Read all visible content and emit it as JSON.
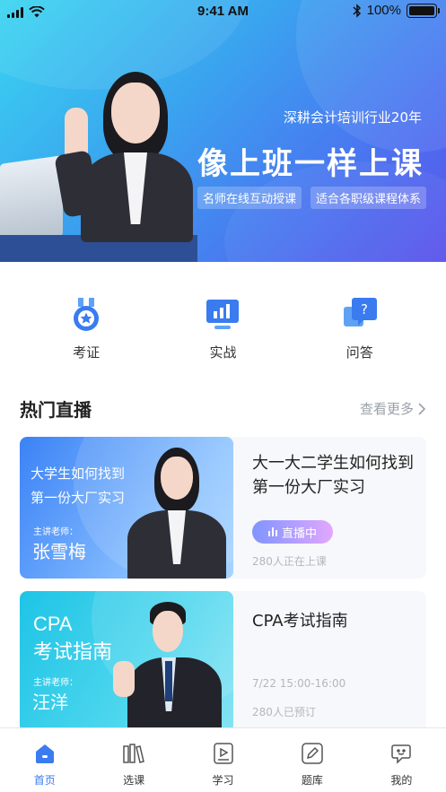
{
  "status_bar": {
    "time": "9:41 AM",
    "battery": "100%",
    "battery_level": 1.0
  },
  "banner": {
    "tagline": "深耕会计培训行业20年",
    "title": "像上班一样上课",
    "tags": [
      "名师在线互动授课",
      "适合各职级课程体系"
    ]
  },
  "quick_entries": [
    {
      "label": "考证",
      "icon": "medal-icon"
    },
    {
      "label": "实战",
      "icon": "monitor-chart-icon"
    },
    {
      "label": "问答",
      "icon": "question-bubble-icon"
    }
  ],
  "hot_live": {
    "title": "热门直播",
    "more_label": "查看更多"
  },
  "courses": [
    {
      "thumb_headline": [
        "大学生如何找到",
        "第一份大厂实习"
      ],
      "teacher_label": "主讲老师：",
      "teacher_name": "张雪梅",
      "title": "大一大二学生如何找到第一份大厂实习",
      "badge": "直播中",
      "meta_lines": [
        "280人正在上课"
      ]
    },
    {
      "thumb_headline": [
        "CPA",
        "考试指南"
      ],
      "teacher_label": "主讲老师：",
      "teacher_name": "汪洋",
      "title": "CPA考试指南",
      "badge": "",
      "meta_lines": [
        "7/22 15:00-16:00",
        "280人已预订"
      ]
    }
  ],
  "tab_bar": [
    {
      "label": "首页",
      "icon": "home-icon",
      "active": true
    },
    {
      "label": "选课",
      "icon": "books-icon",
      "active": false
    },
    {
      "label": "学习",
      "icon": "play-doc-icon",
      "active": false
    },
    {
      "label": "题库",
      "icon": "pen-icon",
      "active": false
    },
    {
      "label": "我的",
      "icon": "profile-icon",
      "active": false
    }
  ],
  "colors": {
    "accent": "#3a7bf0",
    "banner_start": "#39d5f0",
    "banner_end": "#5b52ea",
    "live_badge_start": "#7f95ff",
    "live_badge_end": "#e2a7ff"
  }
}
